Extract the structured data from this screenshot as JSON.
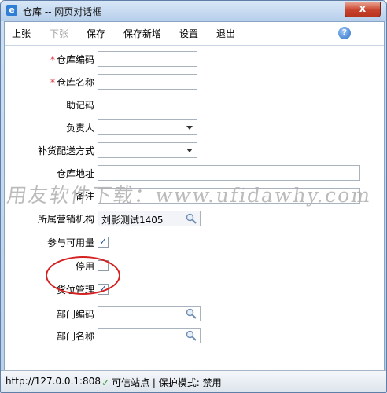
{
  "window": {
    "title": "仓库 -- 网页对话框",
    "close_glyph": "x"
  },
  "toolbar": {
    "items": [
      {
        "label": "上张",
        "enabled": true
      },
      {
        "label": "下张",
        "enabled": false
      },
      {
        "label": "保存",
        "enabled": true
      },
      {
        "label": "保存新增",
        "enabled": true
      },
      {
        "label": "设置",
        "enabled": true
      },
      {
        "label": "退出",
        "enabled": true
      }
    ],
    "help_glyph": "?"
  },
  "form": {
    "required_mark": "*",
    "fields": {
      "code": {
        "label": "仓库编码",
        "value": ""
      },
      "name": {
        "label": "仓库名称",
        "value": ""
      },
      "mnemonic": {
        "label": "助记码",
        "value": ""
      },
      "manager": {
        "label": "负责人",
        "value": ""
      },
      "delivery": {
        "label": "补货配送方式",
        "value": ""
      },
      "address": {
        "label": "仓库地址",
        "value": ""
      },
      "remark": {
        "label": "备注",
        "value": ""
      },
      "org": {
        "label": "所属营销机构",
        "value": "刘影测试1405"
      },
      "available": {
        "label": "参与可用量",
        "checked": true
      },
      "disabled": {
        "label": "停用",
        "checked": false
      },
      "location": {
        "label": "货位管理",
        "checked": true
      },
      "dept_code": {
        "label": "部门编码",
        "value": ""
      },
      "dept_name": {
        "label": "部门名称",
        "value": ""
      }
    }
  },
  "watermark": "用友软件下载：www.ufidawhy.com",
  "status": {
    "url": "http://127.0.0.1:808",
    "zone": "可信站点 | 保护模式: 禁用"
  },
  "colors": {
    "annotation_circle": "#d42020",
    "required": "#dd2233",
    "check": "#1d4f9c"
  }
}
